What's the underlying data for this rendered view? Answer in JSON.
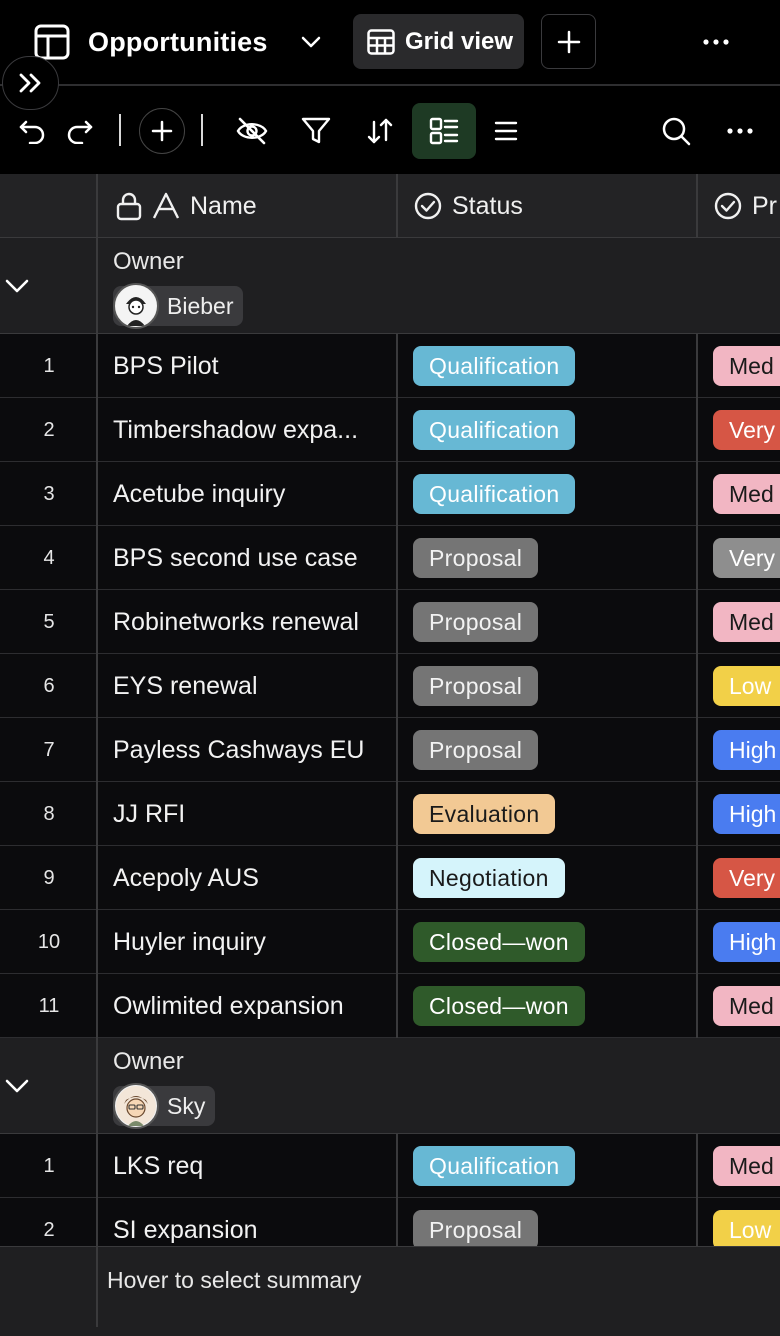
{
  "header": {
    "title": "Opportunities",
    "view_label": "Grid view"
  },
  "columns": {
    "name": "Name",
    "status": "Status",
    "priority": "Pr"
  },
  "groups": [
    {
      "label": "Owner",
      "owner": "Bieber",
      "rows": [
        {
          "num": "1",
          "name": "BPS Pilot",
          "status": "Qualification",
          "priority": "Med"
        },
        {
          "num": "2",
          "name": "Timbershadow expa...",
          "status": "Qualification",
          "priority": "Very"
        },
        {
          "num": "3",
          "name": "Acetube inquiry",
          "status": "Qualification",
          "priority": "Med"
        },
        {
          "num": "4",
          "name": "BPS second use case",
          "status": "Proposal",
          "priority": "Very"
        },
        {
          "num": "5",
          "name": "Robinetworks renewal",
          "status": "Proposal",
          "priority": "Med"
        },
        {
          "num": "6",
          "name": "EYS renewal",
          "status": "Proposal",
          "priority": "Low"
        },
        {
          "num": "7",
          "name": "Payless Cashways EU",
          "status": "Proposal",
          "priority": "High"
        },
        {
          "num": "8",
          "name": "JJ RFI",
          "status": "Evaluation",
          "priority": "High"
        },
        {
          "num": "9",
          "name": "Acepoly AUS",
          "status": "Negotiation",
          "priority": "Very"
        },
        {
          "num": "10",
          "name": "Huyler inquiry",
          "status": "Closed—won",
          "priority": "High"
        },
        {
          "num": "11",
          "name": "Owlimited expansion",
          "status": "Closed—won",
          "priority": "Med"
        }
      ]
    },
    {
      "label": "Owner",
      "owner": "Sky",
      "rows": [
        {
          "num": "1",
          "name": "LKS req",
          "status": "Qualification",
          "priority": "Med"
        },
        {
          "num": "2",
          "name": "SI expansion",
          "status": "Proposal",
          "priority": "Low"
        }
      ]
    }
  ],
  "footer": {
    "summary": "Hover to select summary"
  },
  "colors": {
    "qualification": "#67b8d4",
    "proposal": "#757575",
    "evaluation": "#f2c994",
    "negotiation": "#d5f4fb",
    "closed_won": "#2f5a2a",
    "med": "#f2b6c3",
    "very": "#d65645",
    "very_gray": "#8e8e8e",
    "low": "#f2d048",
    "high": "#4a7cf0",
    "accent_green": "#1e3a24"
  }
}
